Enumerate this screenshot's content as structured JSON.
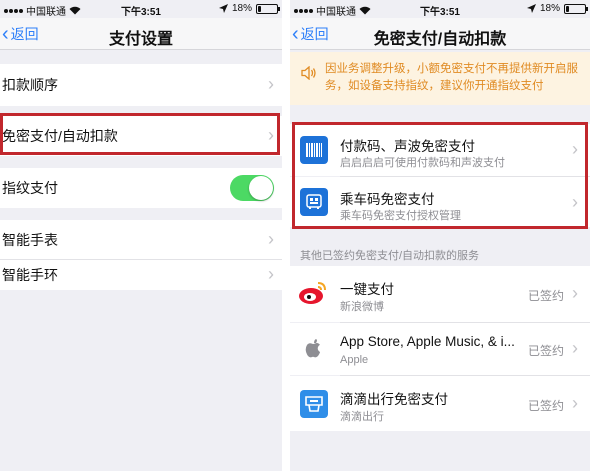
{
  "left": {
    "status": {
      "carrier": "中国联通",
      "time": "下午3:51",
      "battery": "18%",
      "battery_level": 0.18
    },
    "nav": {
      "back": "返回",
      "title": "支付设置"
    },
    "rows": [
      {
        "label": "扣款顺序"
      },
      {
        "label": "免密支付/自动扣款"
      },
      {
        "label": "指纹支付"
      },
      {
        "label": "智能手表"
      },
      {
        "label": "智能手环"
      }
    ],
    "fingerprint_toggle_on": true
  },
  "right": {
    "status": {
      "carrier": "中国联通",
      "time": "下午3:51",
      "battery": "18%",
      "battery_level": 0.18
    },
    "nav": {
      "back": "返回",
      "title": "免密支付/自动扣款"
    },
    "notice": "因业务调整升级，小额免密支付不再提供新开启服务，如设备支持指纹，建议你开通指纹支付",
    "payment_items": [
      {
        "title": "付款码、声波免密支付",
        "subtitle": "启启启启可使用付款码和声波支付",
        "icon": "barcode-icon"
      },
      {
        "title": "乘车码免密支付",
        "subtitle": "乘车码免密支付授权管理",
        "icon": "bus-card-icon"
      }
    ],
    "section_header": "其他已签约免密支付/自动扣款的服务",
    "services": [
      {
        "title": "一键支付",
        "subtitle": "新浪微博",
        "status": "已签约",
        "icon": "weibo-icon"
      },
      {
        "title": "App Store, Apple Music, & i...",
        "subtitle": "Apple",
        "status": "已签约",
        "icon": "apple-icon"
      },
      {
        "title": "滴滴出行免密支付",
        "subtitle": "滴滴出行",
        "status": "已签约",
        "icon": "didi-icon"
      }
    ]
  },
  "colors": {
    "accent": "#2d7ff9",
    "highlight": "#c1272d",
    "toggle": "#4cd964",
    "notice_text": "#e08b23",
    "icon_blue": "#1d72d8"
  }
}
